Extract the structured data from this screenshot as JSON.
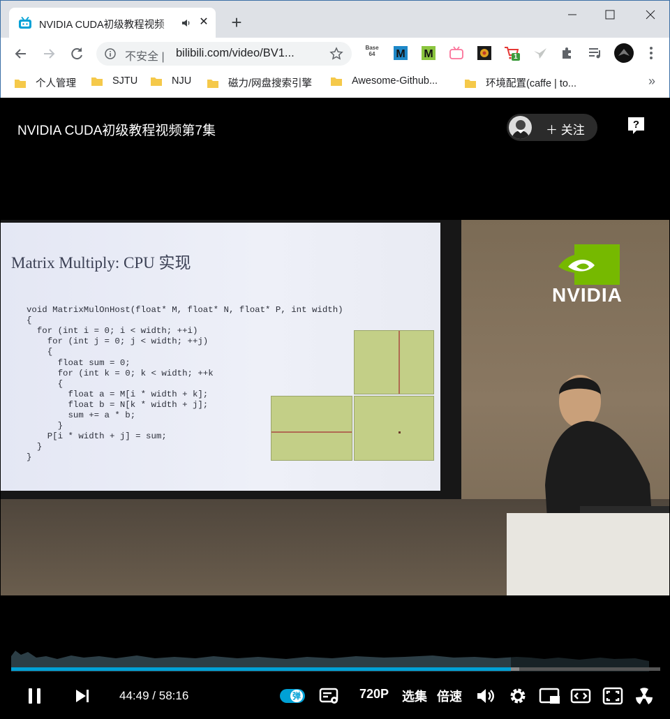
{
  "browser": {
    "tab": {
      "title": "NVIDIA CUDA初级教程视频",
      "audio_icon": "speaker-icon",
      "close_icon": "close-icon"
    },
    "new_tab_icon": "plus-icon",
    "window_controls": [
      "minimize-icon",
      "maximize-icon",
      "close-icon"
    ],
    "omnibox": {
      "security_text": "不安全",
      "separator": "|",
      "url": "bilibili.com/video/BV1..."
    },
    "extensions": [
      "base64-icon",
      "m-extension-icon",
      "m-green-extension-icon",
      "bilibili-tv-icon",
      "flower-extension-icon",
      "cart-extension-icon",
      "bird-extension-icon",
      "puzzle-icon",
      "playlist-icon",
      "profile-avatar",
      "kebab-menu-icon"
    ],
    "cart_badge": "1",
    "bookmarks": [
      "个人管理",
      "SJTU",
      "NJU",
      "磁力/网盘搜索引擎",
      "Awesome-Github...",
      "环境配置(caffe | to..."
    ],
    "bookmarks_more": "»"
  },
  "player": {
    "video_title": "NVIDIA CUDA初级教程视频第7集",
    "follow_label": "关注",
    "time_current": "44:49",
    "time_sep": "/",
    "time_total": "58:16",
    "progress_fraction": 0.77,
    "buffered_fraction": 0.7827,
    "danmaku_label": "弹",
    "quality": "720P",
    "episodes": "选集",
    "speed": "倍速",
    "accent": "#00a1d6"
  },
  "slide": {
    "title": "Matrix Multiply: CPU 实现",
    "code": [
      "void MatrixMulOnHost(float* M, float* N, float* P, int width)",
      "{",
      "  for (int i = 0; i < width; ++i)",
      "    for (int j = 0; j < width; ++j)",
      "    {",
      "      float sum = 0;",
      "      for (int k = 0; k < width; ++k",
      "      {",
      "        float a = M[i * width + k];",
      "        float b = N[k * width + j];",
      "        sum += a * b;",
      "      }",
      "    P[i * width + j] = sum;",
      "  }",
      "}"
    ],
    "logo_text": "NVIDIA"
  }
}
